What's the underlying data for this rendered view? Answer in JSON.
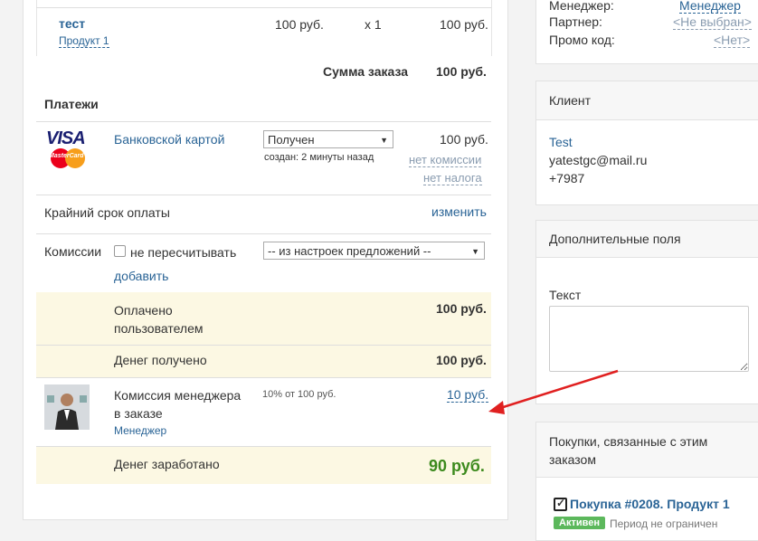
{
  "order_item": {
    "name": "тест",
    "product_link": "Продукт 1",
    "price": "100 руб.",
    "qty": "x 1",
    "total": "100 руб."
  },
  "order_sum": {
    "label": "Сумма заказа",
    "value": "100 руб."
  },
  "payments": {
    "title": "Платежи",
    "visa_logo": "VISA",
    "mastercard_logo": "MasterCard",
    "method": "Банковской картой",
    "status_select": "Получен",
    "created": "создан: 2 минуты назад",
    "amount": "100 руб.",
    "no_commission": "нет комиссии",
    "no_tax": "нет налога"
  },
  "deadline": {
    "label": "Крайний срок оплаты",
    "action": "изменить"
  },
  "commissions": {
    "label": "Комиссии",
    "checkbox_label": "не пересчитывать",
    "add_link": "добавить",
    "select_value": "-- из настроек предложений --"
  },
  "paid_by_user": {
    "label": "Оплачено пользователем",
    "value": "100 руб."
  },
  "money_received": {
    "label": "Денег получено",
    "value": "100 руб."
  },
  "manager_commission": {
    "label": "Комиссия менеджера в заказе",
    "role_link": "Менеджер",
    "detail": "10% от 100 руб.",
    "amount": "10 руб."
  },
  "money_earned": {
    "label": "Денег заработано",
    "value": "90 руб."
  },
  "top_right": {
    "manager_label": "Менеджер:",
    "manager_value": "Менеджер",
    "partner_label": "Партнер:",
    "partner_value": "<Не выбран>",
    "promo_label": "Промо код:",
    "promo_value": "<Нет>"
  },
  "client": {
    "title": "Клиент",
    "name": "Test",
    "email": "yatestgc@mail.ru",
    "phone": "+7987"
  },
  "extra_fields": {
    "title": "Дополнительные поля",
    "text_label": "Текст"
  },
  "related": {
    "title": "Покупки, связанные с этим заказом",
    "purchase": "Покупка #0208. Продукт 1",
    "badge": "Активен",
    "period": "Период не ограничен"
  },
  "colors": {
    "link": "#2a6496",
    "highlight_bg": "#fcf8e3",
    "earned_green": "#3c8a1d",
    "arrow_red": "#e02020",
    "badge_green": "#5cb85c"
  }
}
